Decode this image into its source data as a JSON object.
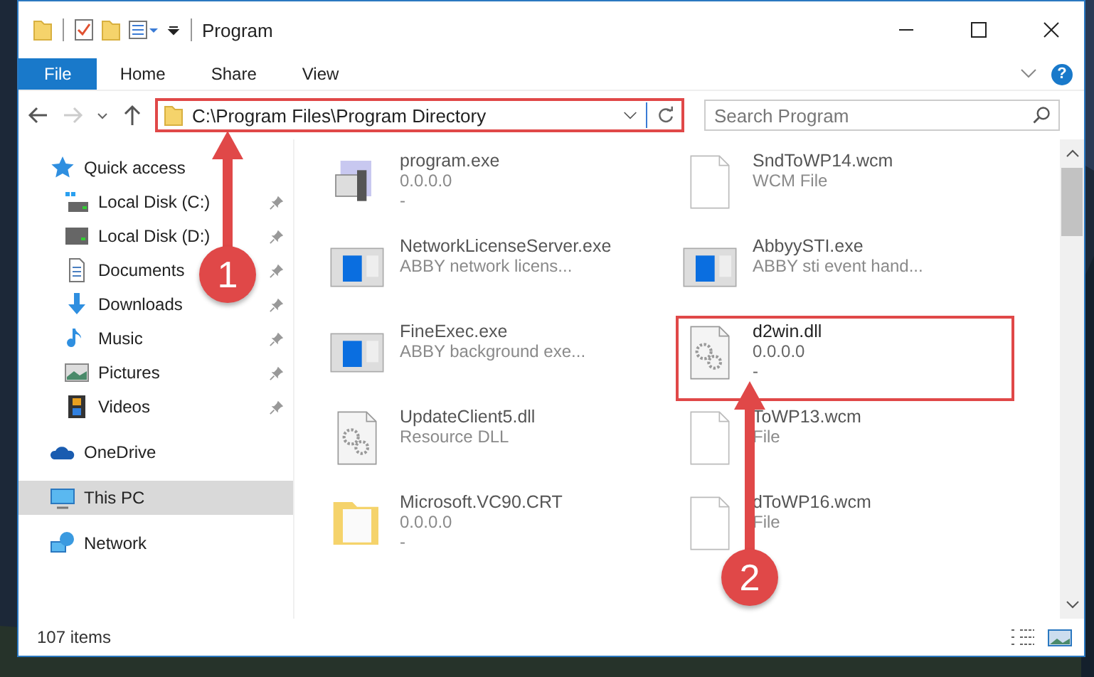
{
  "window": {
    "title": "Program"
  },
  "ribbon_tabs": [
    {
      "label": "File",
      "selected": true
    },
    {
      "label": "Home",
      "selected": false
    },
    {
      "label": "Share",
      "selected": false
    },
    {
      "label": "View",
      "selected": false
    }
  ],
  "help": "?",
  "nav": {
    "forward_disabled": true
  },
  "address": {
    "value": "C:\\Program Files\\Program Directory",
    "highlighted": true
  },
  "search": {
    "placeholder": "Search Program"
  },
  "sidebar": {
    "items": [
      {
        "label": "Quick access",
        "kind": "star",
        "group": true,
        "pinned": false,
        "selected": false
      },
      {
        "label": "Local Disk (C:)",
        "kind": "windisk",
        "group": false,
        "pinned": true,
        "selected": false
      },
      {
        "label": "Local Disk (D:)",
        "kind": "disk",
        "group": false,
        "pinned": true,
        "selected": false
      },
      {
        "label": "Documents",
        "kind": "document",
        "group": false,
        "pinned": true,
        "selected": false
      },
      {
        "label": "Downloads",
        "kind": "download",
        "group": false,
        "pinned": true,
        "selected": false
      },
      {
        "label": "Music",
        "kind": "music",
        "group": false,
        "pinned": true,
        "selected": false
      },
      {
        "label": "Pictures",
        "kind": "pictures",
        "group": false,
        "pinned": true,
        "selected": false
      },
      {
        "label": "Videos",
        "kind": "videos",
        "group": false,
        "pinned": true,
        "selected": false
      },
      {
        "label": "OneDrive",
        "kind": "cloud",
        "group": true,
        "pinned": false,
        "selected": false
      },
      {
        "label": "This PC",
        "kind": "computer",
        "group": true,
        "pinned": false,
        "selected": true
      },
      {
        "label": "Network",
        "kind": "network",
        "group": true,
        "pinned": false,
        "selected": false
      }
    ]
  },
  "files": [
    {
      "name": "program.exe",
      "lines": [
        "0.0.0.0",
        "-"
      ],
      "kind": "installer",
      "dimmed": true,
      "highlighted": false
    },
    {
      "name": "SndToWP14.wcm",
      "lines": [
        "WCM File"
      ],
      "kind": "blank",
      "dimmed": true,
      "highlighted": false
    },
    {
      "name": "NetworkLicenseServer.exe",
      "lines": [
        "ABBY network licens..."
      ],
      "kind": "window",
      "dimmed": true,
      "highlighted": false
    },
    {
      "name": "AbbyySTI.exe",
      "lines": [
        "ABBY sti event hand..."
      ],
      "kind": "window",
      "dimmed": true,
      "highlighted": false
    },
    {
      "name": "FineExec.exe",
      "lines": [
        "ABBY background exe..."
      ],
      "kind": "window",
      "dimmed": true,
      "highlighted": false
    },
    {
      "name": "d2win.dll",
      "lines": [
        "0.0.0.0",
        "-"
      ],
      "kind": "gears",
      "dimmed": false,
      "highlighted": true
    },
    {
      "name": "UpdateClient5.dll",
      "lines": [
        "Resource DLL"
      ],
      "kind": "gears",
      "dimmed": true,
      "highlighted": false
    },
    {
      "name": "ToWP13.wcm",
      "lines": [
        "File"
      ],
      "kind": "blank",
      "dimmed": true,
      "highlighted": false
    },
    {
      "name": "Microsoft.VC90.CRT",
      "lines": [
        "0.0.0.0",
        "-"
      ],
      "kind": "folder",
      "dimmed": true,
      "highlighted": false
    },
    {
      "name": "dToWP16.wcm",
      "lines": [
        "File"
      ],
      "kind": "blank",
      "dimmed": true,
      "highlighted": false
    }
  ],
  "annotations": [
    {
      "number": "1"
    },
    {
      "number": "2"
    }
  ],
  "status_bar": {
    "count": "107 items"
  }
}
